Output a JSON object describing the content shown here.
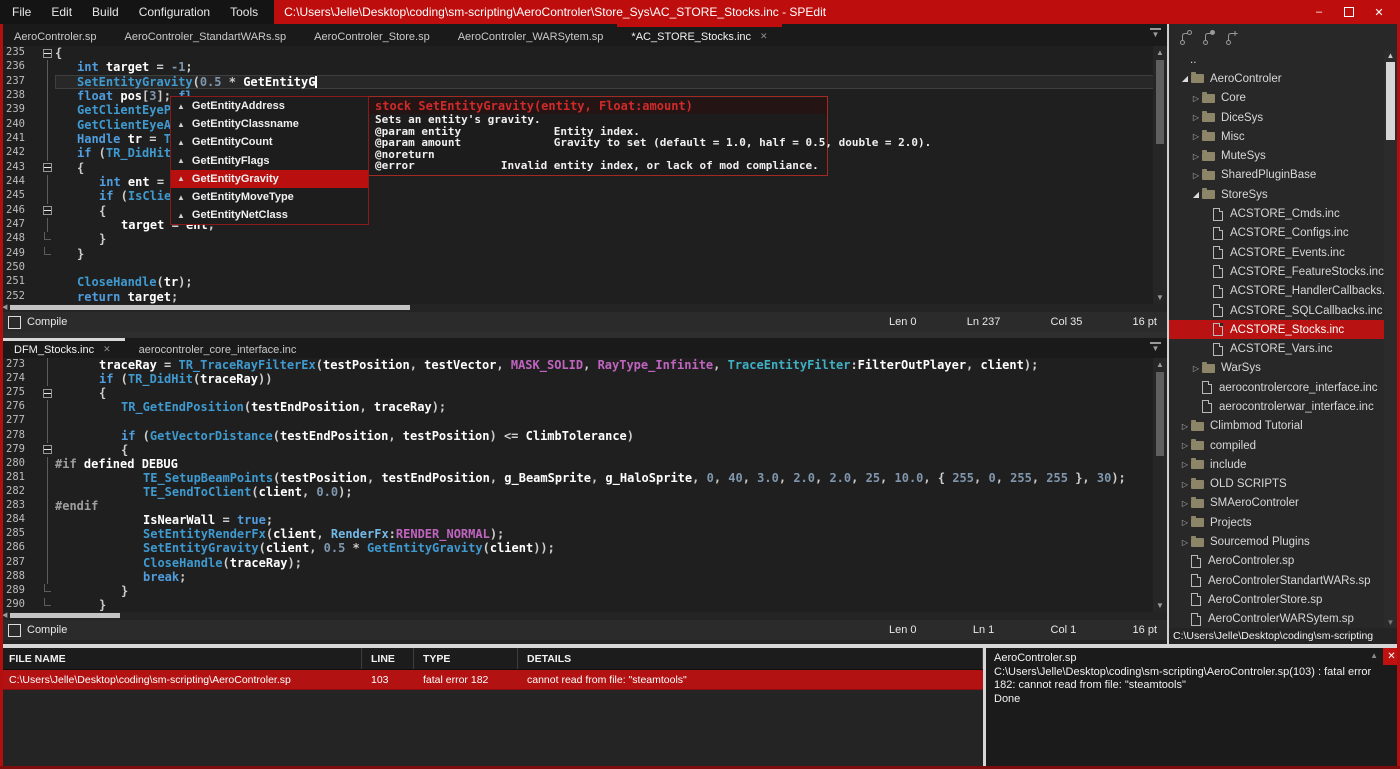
{
  "titlebar": {
    "menus": [
      "File",
      "Edit",
      "Build",
      "Configuration",
      "Tools"
    ],
    "title": "C:\\Users\\Jelle\\Desktop\\coding\\sm-scripting\\AeroControler\\Store_Sys\\AC_STORE_Stocks.inc - SPEdit"
  },
  "editor_top": {
    "tabs": [
      {
        "label": "AeroControler.sp"
      },
      {
        "label": "AeroControler_StandartWARs.sp"
      },
      {
        "label": "AeroControler_Store.sp"
      },
      {
        "label": "AeroControler_WARSytem.sp"
      },
      {
        "label": "*AC_STORE_Stocks.inc",
        "active": true,
        "close": true
      }
    ],
    "lines": [
      {
        "n": "235",
        "fold": "start",
        "ind": 0,
        "tok": [
          [
            "pl",
            "{"
          ]
        ]
      },
      {
        "n": "236",
        "fold": "mid",
        "ind": 1,
        "tok": [
          [
            "kw",
            "int"
          ],
          [
            "pl",
            " "
          ],
          [
            "var",
            "target"
          ],
          [
            "pl",
            " = "
          ],
          [
            "num",
            "-1"
          ],
          [
            "pl",
            ";"
          ]
        ]
      },
      {
        "n": "237",
        "fold": "mid",
        "ind": 1,
        "cur": true,
        "tok": [
          [
            "fn",
            "SetEntityGravity"
          ],
          [
            "pl",
            "("
          ],
          [
            "num",
            "0.5"
          ],
          [
            "pl",
            " * "
          ],
          [
            "var",
            "GetEntityG"
          ],
          [
            "cursor",
            ""
          ]
        ]
      },
      {
        "n": "238",
        "fold": "mid",
        "ind": 1,
        "tok": [
          [
            "kw",
            "float"
          ],
          [
            "pl",
            " "
          ],
          [
            "var",
            "pos"
          ],
          [
            "pl",
            "["
          ],
          [
            "num",
            "3"
          ],
          [
            "pl",
            "]; "
          ],
          [
            "kw",
            "fl"
          ]
        ]
      },
      {
        "n": "239",
        "fold": "mid",
        "ind": 1,
        "tok": [
          [
            "fn",
            "GetClientEyePos"
          ]
        ]
      },
      {
        "n": "240",
        "fold": "mid",
        "ind": 1,
        "tok": [
          [
            "fn",
            "GetClientEyeAng"
          ]
        ]
      },
      {
        "n": "241",
        "fold": "mid",
        "ind": 1,
        "tok": [
          [
            "kw",
            "Handle"
          ],
          [
            "pl",
            " "
          ],
          [
            "var",
            "tr"
          ],
          [
            "pl",
            " = "
          ],
          [
            "fn",
            "TR_"
          ]
        ]
      },
      {
        "n": "242",
        "fold": "mid",
        "ind": 1,
        "tok": [
          [
            "kw",
            "if"
          ],
          [
            "pl",
            " ("
          ],
          [
            "fn",
            "TR_DidHit"
          ],
          [
            "pl",
            "("
          ],
          [
            "var",
            "tr"
          ]
        ]
      },
      {
        "n": "243",
        "fold": "start",
        "ind": 1,
        "tok": [
          [
            "pl",
            "{"
          ]
        ]
      },
      {
        "n": "244",
        "fold": "mid",
        "ind": 2,
        "tok": [
          [
            "kw",
            "int"
          ],
          [
            "pl",
            " "
          ],
          [
            "var",
            "ent"
          ],
          [
            "pl",
            " = "
          ],
          [
            "fn",
            "TR"
          ]
        ]
      },
      {
        "n": "245",
        "fold": "mid",
        "ind": 2,
        "tok": [
          [
            "kw",
            "if"
          ],
          [
            "pl",
            " ("
          ],
          [
            "fn",
            "IsClient"
          ]
        ]
      },
      {
        "n": "246",
        "fold": "start",
        "ind": 2,
        "tok": [
          [
            "pl",
            "{"
          ]
        ]
      },
      {
        "n": "247",
        "fold": "mid",
        "ind": 3,
        "tok": [
          [
            "var",
            "target"
          ],
          [
            "pl",
            " = "
          ],
          [
            "var",
            "ent"
          ],
          [
            "pl",
            ";"
          ]
        ]
      },
      {
        "n": "248",
        "fold": "end",
        "ind": 2,
        "tok": [
          [
            "pl",
            "}"
          ]
        ]
      },
      {
        "n": "249",
        "fold": "end",
        "ind": 1,
        "tok": [
          [
            "pl",
            "}"
          ]
        ]
      },
      {
        "n": "250",
        "fold": "",
        "ind": 0,
        "tok": []
      },
      {
        "n": "251",
        "fold": "",
        "ind": 1,
        "tok": [
          [
            "fn",
            "CloseHandle"
          ],
          [
            "pl",
            "("
          ],
          [
            "var",
            "tr"
          ],
          [
            "pl",
            ");"
          ]
        ]
      },
      {
        "n": "252",
        "fold": "",
        "ind": 1,
        "tok": [
          [
            "kw",
            "return"
          ],
          [
            "pl",
            " "
          ],
          [
            "var",
            "target"
          ],
          [
            "pl",
            ";"
          ]
        ]
      }
    ],
    "status": {
      "compile": "Compile",
      "len": "Len 0",
      "ln": "Ln 237",
      "col": "Col 35",
      "size": "16 pt"
    }
  },
  "autocomplete": {
    "items": [
      "GetEntityAddress",
      "GetEntityClassname",
      "GetEntityCount",
      "GetEntityFlags",
      "GetEntityGravity",
      "GetEntityMoveType",
      "GetEntityNetClass"
    ],
    "selected": 4
  },
  "tooltip": {
    "signature": "stock SetEntityGravity(entity, Float:amount)",
    "lines": [
      "Sets an entity's gravity.",
      "@param entity              Entity index.",
      "@param amount              Gravity to set (default = 1.0, half = 0.5, double = 2.0).",
      "@noreturn",
      "@error             Invalid entity index, or lack of mod compliance."
    ]
  },
  "editor_bottom": {
    "tabs": [
      {
        "label": "DFM_Stocks.inc",
        "active": true,
        "close": true
      },
      {
        "label": "aerocontroler_core_interface.inc"
      }
    ],
    "lines": [
      {
        "n": "273",
        "fold": "mid",
        "ind": 2,
        "tok": [
          [
            "var",
            "traceRay"
          ],
          [
            "pl",
            " = "
          ],
          [
            "fn",
            "TR_TraceRayFilterEx"
          ],
          [
            "pl",
            "("
          ],
          [
            "var",
            "testPosition"
          ],
          [
            "pl",
            ", "
          ],
          [
            "var",
            "testVector"
          ],
          [
            "pl",
            ", "
          ],
          [
            "const",
            "MASK_SOLID"
          ],
          [
            "pl",
            ", "
          ],
          [
            "const",
            "RayType_Infinite"
          ],
          [
            "pl",
            ", "
          ],
          [
            "teal",
            "TraceEntityFilter"
          ],
          [
            "pl",
            ":"
          ],
          [
            "var",
            "FilterOutPlayer"
          ],
          [
            "pl",
            ", "
          ],
          [
            "var",
            "client"
          ],
          [
            "pl",
            ");"
          ]
        ]
      },
      {
        "n": "274",
        "fold": "mid",
        "ind": 2,
        "tok": [
          [
            "kw",
            "if"
          ],
          [
            "pl",
            " ("
          ],
          [
            "fn",
            "TR_DidHit"
          ],
          [
            "pl",
            "("
          ],
          [
            "var",
            "traceRay"
          ],
          [
            "pl",
            "))"
          ]
        ]
      },
      {
        "n": "275",
        "fold": "start",
        "ind": 2,
        "tok": [
          [
            "pl",
            "{"
          ]
        ]
      },
      {
        "n": "276",
        "fold": "mid",
        "ind": 3,
        "tok": [
          [
            "fn",
            "TR_GetEndPosition"
          ],
          [
            "pl",
            "("
          ],
          [
            "var",
            "testEndPosition"
          ],
          [
            "pl",
            ", "
          ],
          [
            "var",
            "traceRay"
          ],
          [
            "pl",
            ");"
          ]
        ]
      },
      {
        "n": "277",
        "fold": "mid",
        "ind": 0,
        "tok": []
      },
      {
        "n": "278",
        "fold": "mid",
        "ind": 3,
        "tok": [
          [
            "kw",
            "if"
          ],
          [
            "pl",
            " ("
          ],
          [
            "fn",
            "GetVectorDistance"
          ],
          [
            "pl",
            "("
          ],
          [
            "var",
            "testEndPosition"
          ],
          [
            "pl",
            ", "
          ],
          [
            "var",
            "testPosition"
          ],
          [
            "pl",
            ") <= "
          ],
          [
            "var",
            "ClimbTolerance"
          ],
          [
            "pl",
            ")"
          ]
        ]
      },
      {
        "n": "279",
        "fold": "start",
        "ind": 3,
        "tok": [
          [
            "pl",
            "{"
          ]
        ]
      },
      {
        "n": "280",
        "fold": "mid",
        "ind": 0,
        "tok": [
          [
            "pp",
            "#if "
          ],
          [
            "var",
            "defined DEBUG"
          ]
        ]
      },
      {
        "n": "281",
        "fold": "mid",
        "ind": 4,
        "tok": [
          [
            "fn",
            "TE_SetupBeamPoints"
          ],
          [
            "pl",
            "("
          ],
          [
            "var",
            "testPosition"
          ],
          [
            "pl",
            ", "
          ],
          [
            "var",
            "testEndPosition"
          ],
          [
            "pl",
            ", "
          ],
          [
            "var",
            "g_BeamSprite"
          ],
          [
            "pl",
            ", "
          ],
          [
            "var",
            "g_HaloSprite"
          ],
          [
            "pl",
            ", "
          ],
          [
            "num",
            "0"
          ],
          [
            "pl",
            ", "
          ],
          [
            "num",
            "40"
          ],
          [
            "pl",
            ", "
          ],
          [
            "num",
            "3.0"
          ],
          [
            "pl",
            ", "
          ],
          [
            "num",
            "2.0"
          ],
          [
            "pl",
            ", "
          ],
          [
            "num",
            "2.0"
          ],
          [
            "pl",
            ", "
          ],
          [
            "num",
            "25"
          ],
          [
            "pl",
            ", "
          ],
          [
            "num",
            "10.0"
          ],
          [
            "pl",
            ", { "
          ],
          [
            "num",
            "255"
          ],
          [
            "pl",
            ", "
          ],
          [
            "num",
            "0"
          ],
          [
            "pl",
            ", "
          ],
          [
            "num",
            "255"
          ],
          [
            "pl",
            ", "
          ],
          [
            "num",
            "255"
          ],
          [
            "pl",
            " }, "
          ],
          [
            "num",
            "30"
          ],
          [
            "pl",
            ");"
          ]
        ]
      },
      {
        "n": "282",
        "fold": "mid",
        "ind": 4,
        "tok": [
          [
            "fn",
            "TE_SendToClient"
          ],
          [
            "pl",
            "("
          ],
          [
            "var",
            "client"
          ],
          [
            "pl",
            ", "
          ],
          [
            "num",
            "0.0"
          ],
          [
            "pl",
            ");"
          ]
        ]
      },
      {
        "n": "283",
        "fold": "mid",
        "ind": 0,
        "tok": [
          [
            "pp",
            "#endif"
          ]
        ]
      },
      {
        "n": "284",
        "fold": "mid",
        "ind": 4,
        "tok": [
          [
            "var",
            "IsNearWall"
          ],
          [
            "pl",
            " = "
          ],
          [
            "kw",
            "true"
          ],
          [
            "pl",
            ";"
          ]
        ]
      },
      {
        "n": "285",
        "fold": "mid",
        "ind": 4,
        "tok": [
          [
            "fn",
            "SetEntityRenderFx"
          ],
          [
            "pl",
            "("
          ],
          [
            "var",
            "client"
          ],
          [
            "pl",
            ", "
          ],
          [
            "tag",
            "RenderFx"
          ],
          [
            "pl",
            ":"
          ],
          [
            "const",
            "RENDER_NORMAL"
          ],
          [
            "pl",
            ");"
          ]
        ]
      },
      {
        "n": "286",
        "fold": "mid",
        "ind": 4,
        "tok": [
          [
            "fn",
            "SetEntityGravity"
          ],
          [
            "pl",
            "("
          ],
          [
            "var",
            "client"
          ],
          [
            "pl",
            ", "
          ],
          [
            "num",
            "0.5"
          ],
          [
            "pl",
            " * "
          ],
          [
            "fn",
            "GetEntityGravity"
          ],
          [
            "pl",
            "("
          ],
          [
            "var",
            "client"
          ],
          [
            "pl",
            "));"
          ]
        ]
      },
      {
        "n": "287",
        "fold": "mid",
        "ind": 4,
        "tok": [
          [
            "fn",
            "CloseHandle"
          ],
          [
            "pl",
            "("
          ],
          [
            "var",
            "traceRay"
          ],
          [
            "pl",
            ");"
          ]
        ]
      },
      {
        "n": "288",
        "fold": "mid",
        "ind": 4,
        "tok": [
          [
            "kw",
            "break"
          ],
          [
            "pl",
            ";"
          ]
        ]
      },
      {
        "n": "289",
        "fold": "end",
        "ind": 3,
        "tok": [
          [
            "pl",
            "}"
          ]
        ]
      },
      {
        "n": "290",
        "fold": "end",
        "ind": 2,
        "tok": [
          [
            "pl",
            "}"
          ]
        ]
      }
    ],
    "status": {
      "compile": "Compile",
      "len": "Len 0",
      "ln": "Ln 1",
      "col": "Col 1",
      "size": "16 pt"
    }
  },
  "sidebar": {
    "tree": [
      {
        "label": "..",
        "type": "up",
        "level": 1
      },
      {
        "label": "AeroControler",
        "type": "folder",
        "level": 0,
        "open": true
      },
      {
        "label": "Core",
        "type": "folder",
        "level": 1
      },
      {
        "label": "DiceSys",
        "type": "folder",
        "level": 1
      },
      {
        "label": "Misc",
        "type": "folder",
        "level": 1
      },
      {
        "label": "MuteSys",
        "type": "folder",
        "level": 1
      },
      {
        "label": "SharedPluginBase",
        "type": "folder",
        "level": 1
      },
      {
        "label": "StoreSys",
        "type": "folder",
        "level": 1,
        "open": true
      },
      {
        "label": "ACSTORE_Cmds.inc",
        "type": "file",
        "level": 2
      },
      {
        "label": "ACSTORE_Configs.inc",
        "type": "file",
        "level": 2
      },
      {
        "label": "ACSTORE_Events.inc",
        "type": "file",
        "level": 2
      },
      {
        "label": "ACSTORE_FeatureStocks.inc",
        "type": "file",
        "level": 2
      },
      {
        "label": "ACSTORE_HandlerCallbacks.inc",
        "type": "file",
        "level": 2
      },
      {
        "label": "ACSTORE_SQLCallbacks.inc",
        "type": "file",
        "level": 2
      },
      {
        "label": "ACSTORE_Stocks.inc",
        "type": "file",
        "level": 2,
        "selected": true
      },
      {
        "label": "ACSTORE_Vars.inc",
        "type": "file",
        "level": 2
      },
      {
        "label": "WarSys",
        "type": "folder",
        "level": 1
      },
      {
        "label": "aerocontrolercore_interface.inc",
        "type": "file",
        "level": 1
      },
      {
        "label": "aerocontrolerwar_interface.inc",
        "type": "file",
        "level": 1
      },
      {
        "label": "Climbmod Tutorial",
        "type": "folder",
        "level": 0
      },
      {
        "label": "compiled",
        "type": "folder",
        "level": 0
      },
      {
        "label": "include",
        "type": "folder",
        "level": 0
      },
      {
        "label": "OLD SCRIPTS",
        "type": "folder",
        "level": 0
      },
      {
        "label": "SMAeroControler",
        "type": "folder",
        "level": 0
      },
      {
        "label": "Projects",
        "type": "folder",
        "level": 0
      },
      {
        "label": "Sourcemod Plugins",
        "type": "folder",
        "level": 0
      },
      {
        "label": "AeroControler.sp",
        "type": "file",
        "level": 0
      },
      {
        "label": "AeroControlerStandartWARs.sp",
        "type": "file",
        "level": 0
      },
      {
        "label": "AeroControlerStore.sp",
        "type": "file",
        "level": 0
      },
      {
        "label": "AeroControlerWARSytem.sp",
        "type": "file",
        "level": 0
      }
    ],
    "path": "C:\\Users\\Jelle\\Desktop\\coding\\sm-scripting"
  },
  "errors": {
    "headers": [
      "FILE NAME",
      "LINE",
      "TYPE",
      "DETAILS"
    ],
    "rows": [
      {
        "file": "C:\\Users\\Jelle\\Desktop\\coding\\sm-scripting\\AeroControler.sp",
        "line": "103",
        "type": "fatal error 182",
        "details": "cannot read from file: \"steamtools\""
      }
    ]
  },
  "output": {
    "lines": [
      "AeroControler.sp",
      "C:\\Users\\Jelle\\Desktop\\coding\\sm-scripting\\AeroControler.sp(103) : fatal error 182: cannot read from file: \"steamtools\"",
      "Done"
    ]
  }
}
